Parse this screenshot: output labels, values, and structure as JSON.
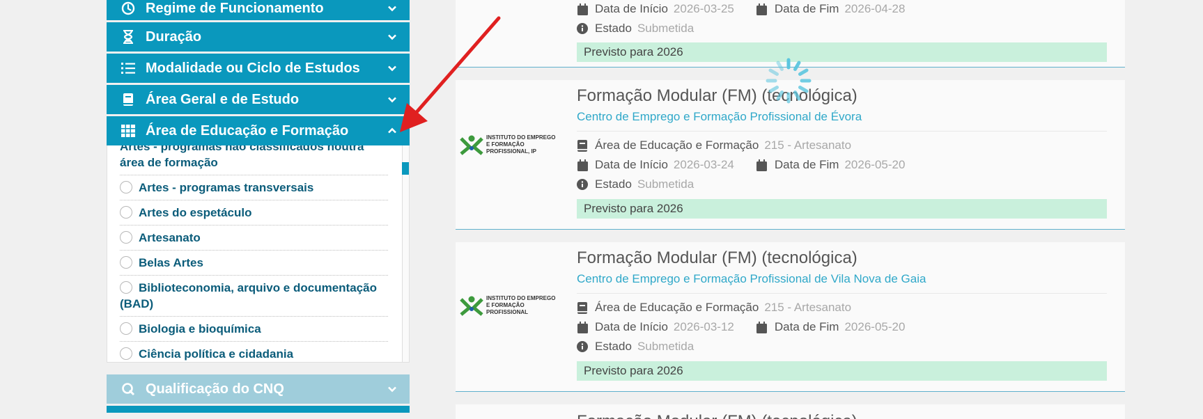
{
  "filters": {
    "headers": [
      {
        "label": "Regime de Funcionamento",
        "icon": "clock-icon"
      },
      {
        "label": "Duração",
        "icon": "hourglass-icon"
      },
      {
        "label": "Modalidade ou Ciclo de Estudos",
        "icon": "list-icon"
      },
      {
        "label": "Área Geral e de Estudo",
        "icon": "book-icon"
      },
      {
        "label": "Área de Educação e Formação",
        "icon": "grid-icon"
      }
    ],
    "area_options": [
      {
        "label": "Artes - programas não classificados noutra área de formação"
      },
      {
        "label": "Artes - programas transversais"
      },
      {
        "label": "Artes do espetáculo"
      },
      {
        "label": "Artesanato"
      },
      {
        "label": "Belas Artes"
      },
      {
        "label": "Biblioteconomia, arquivo e documentação (BAD)"
      },
      {
        "label": "Biologia e bioquímica"
      },
      {
        "label": "Ciência política e cidadania"
      }
    ],
    "next_header": {
      "label": "Qualificação do CNQ",
      "icon": "q-icon"
    }
  },
  "results": [
    {
      "start_label": "Data de Início",
      "start": "2026-03-25",
      "end_label": "Data de Fim",
      "end": "2026-04-28",
      "status_label": "Estado",
      "status": "Submetida",
      "banner": "Previsto para 2026"
    },
    {
      "title": "Formação Modular (FM) (tecnológica)",
      "center": "Centro de Emprego e Formação Profissional de Évora",
      "logo_line1": "INSTITUTO DO EMPREGO",
      "logo_line2": "E FORMAÇÃO PROFISSIONAL, IP",
      "area_label": "Área de Educação e Formação",
      "area": "215 - Artesanato",
      "start_label": "Data de Início",
      "start": "2026-03-24",
      "end_label": "Data de Fim",
      "end": "2026-05-20",
      "status_label": "Estado",
      "status": "Submetida",
      "banner": "Previsto para 2026"
    },
    {
      "title": "Formação Modular (FM) (tecnológica)",
      "center": "Centro de Emprego e Formação Profissional de Vila Nova de Gaia",
      "logo_line1": "INSTITUTO DO EMPREGO",
      "logo_line2": "E FORMAÇÃO PROFISSIONAL",
      "area_label": "Área de Educação e Formação",
      "area": "215 - Artesanato",
      "start_label": "Data de Início",
      "start": "2026-03-12",
      "end_label": "Data de Fim",
      "end": "2026-05-20",
      "status_label": "Estado",
      "status": "Submetida",
      "banner": "Previsto para 2026"
    },
    {
      "title": "Formação Modular (FM) (tecnológica)"
    }
  ],
  "colors": {
    "accent": "#0a98bd",
    "accent_disabled": "#9fcddb",
    "link": "#2fa8c9",
    "banner_bg": "#c9f0dc",
    "arrow": "#e02020",
    "iefp_green": "#3d9a3d",
    "iefp_blue": "#1f5fa8"
  }
}
